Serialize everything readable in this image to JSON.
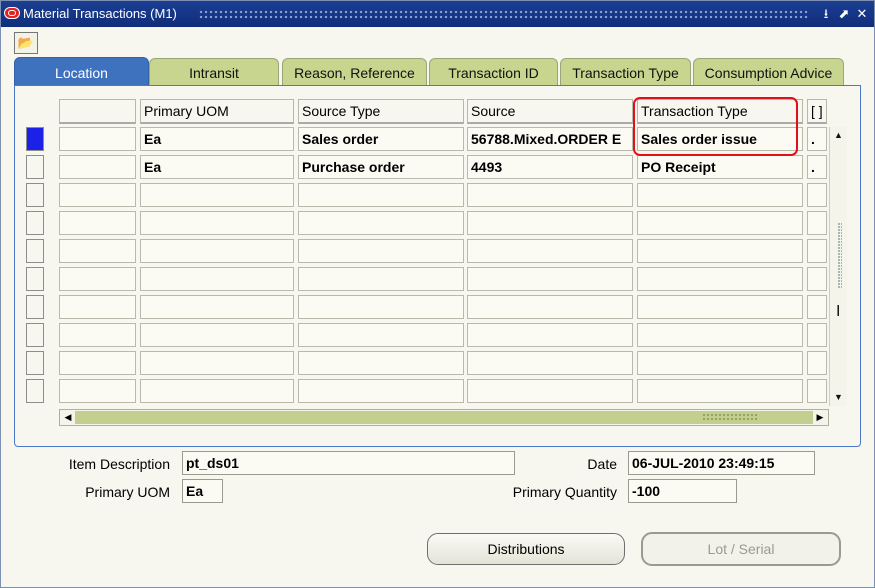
{
  "window": {
    "title": "Material Transactions (M1)",
    "buttons": [
      "⭳",
      "⬈",
      "✕"
    ]
  },
  "toolbar": {
    "open_icon": "folder-icon"
  },
  "tabs": [
    {
      "label": "Location",
      "active": true
    },
    {
      "label": "Intransit",
      "active": false
    },
    {
      "label": "Reason, Reference",
      "active": false
    },
    {
      "label": "Transaction ID",
      "active": false
    },
    {
      "label": "Transaction Type",
      "active": false
    },
    {
      "label": "Consumption Advice",
      "active": false
    }
  ],
  "grid": {
    "columns": [
      "",
      "Primary UOM",
      "Source Type",
      "Source",
      "Transaction Type",
      "[ ]"
    ],
    "rows": [
      [
        "",
        "Ea",
        "Sales order",
        "56788.Mixed.ORDER E",
        "Sales order issue",
        "."
      ],
      [
        "",
        "Ea",
        "Purchase order",
        "4493",
        "PO Receipt",
        "."
      ],
      [
        "",
        "",
        "",
        "",
        "",
        ""
      ],
      [
        "",
        "",
        "",
        "",
        "",
        ""
      ],
      [
        "",
        "",
        "",
        "",
        "",
        ""
      ],
      [
        "",
        "",
        "",
        "",
        "",
        ""
      ],
      [
        "",
        "",
        "",
        "",
        "",
        ""
      ],
      [
        "",
        "",
        "",
        "",
        "",
        ""
      ],
      [
        "",
        "",
        "",
        "",
        "",
        ""
      ],
      [
        "",
        "",
        "",
        "",
        "",
        ""
      ]
    ],
    "current_row": 0
  },
  "details": {
    "item_description_label": "Item Description",
    "item_description": "pt_ds01",
    "primary_uom_label": "Primary UOM",
    "primary_uom": "Ea",
    "date_label": "Date",
    "date": "06-JUL-2010 23:49:15",
    "primary_quantity_label": "Primary Quantity",
    "primary_quantity": "-100"
  },
  "buttons": {
    "distributions": "Distributions",
    "lot_serial": "Lot / Serial"
  },
  "colors": {
    "active_tab": "#3e72bf",
    "inactive_tab": "#c7d58f",
    "highlight": "#e0101a",
    "current_record": "#1c21e8"
  }
}
